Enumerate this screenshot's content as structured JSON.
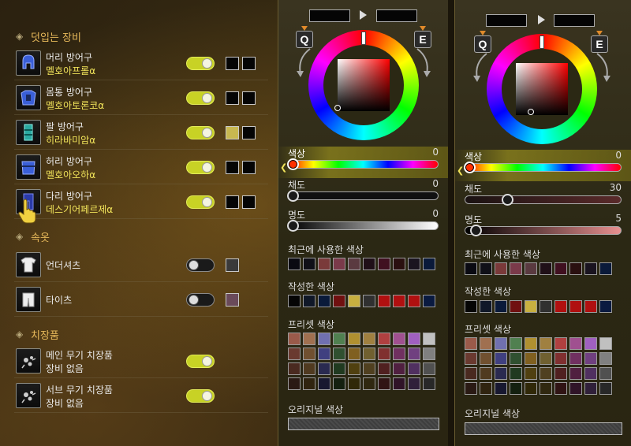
{
  "sections": {
    "armor_title": "덧입는 장비",
    "inner_title": "속옷",
    "decor_title": "치장품"
  },
  "armor": [
    {
      "type": "머리 방어구",
      "name": "멜호아프롤α",
      "toggle": "on",
      "swatches": [
        "#050505",
        "#050505"
      ],
      "icon": "helmet-icon"
    },
    {
      "type": "몸통 방어구",
      "name": "멜호아토론코α",
      "toggle": "on",
      "swatches": [
        "#050505",
        "#050505"
      ],
      "icon": "chest-armor-icon"
    },
    {
      "type": "팔 방어구",
      "name": "히라바미암α",
      "toggle": "on",
      "swatches": [
        "#c8b850",
        "#050505"
      ],
      "icon": "arm-armor-icon"
    },
    {
      "type": "허리 방어구",
      "name": "멜호아오하α",
      "toggle": "on",
      "swatches": [
        "#050505",
        "#050505"
      ],
      "icon": "waist-armor-icon"
    },
    {
      "type": "다리 방어구",
      "name": "데스기어페르제α",
      "toggle": "on",
      "swatches": [
        "#050505",
        "#050505"
      ],
      "icon": "leg-armor-icon"
    }
  ],
  "inner": [
    {
      "type": "언더셔츠",
      "toggle": "off",
      "swatch": "#3a3a3a",
      "icon": "undershirt-icon"
    },
    {
      "type": "타이츠",
      "toggle": "off",
      "swatch": "#6a4a5a",
      "icon": "tights-icon"
    }
  ],
  "decor": [
    {
      "type": "메인 무기 치장품",
      "name": "장비 없음",
      "toggle": "on",
      "icon": "weapon-decor-icon"
    },
    {
      "type": "서브 무기 치장품",
      "name": "장비 없음",
      "toggle": "on",
      "icon": "weapon-decor-icon"
    }
  ],
  "keys": {
    "left": "Q",
    "right": "E"
  },
  "labels": {
    "hue": "색상",
    "saturation": "채도",
    "brightness": "명도",
    "recent": "최근에 사용한 색상",
    "created": "작성한 색상",
    "preset": "프리셋 색상",
    "original": "오리지널 색상"
  },
  "panel_a": {
    "hue": 0,
    "saturation": 0,
    "brightness": 0
  },
  "panel_b": {
    "hue": 0,
    "saturation": 30,
    "brightness": 5
  },
  "colors": {
    "recent": [
      "#0a0a12",
      "#101018",
      "#7a3a3a",
      "#7a3a4a",
      "#5a3a40",
      "#201018",
      "#401020",
      "#2a1010",
      "#1a1420",
      "#0a1a3a"
    ],
    "created": [
      "#050505",
      "#101828",
      "#0a1a3a",
      "#701010",
      "#c8b040",
      "#303030",
      "#b01010",
      "#b01010",
      "#b01010",
      "#0a1a40"
    ],
    "preset": [
      "#9a5a4a",
      "#a07050",
      "#7070b0",
      "#508050",
      "#b09030",
      "#a08040",
      "#b04040",
      "#a05090",
      "#a060c0",
      "#c0c0c0",
      "#6a3a30",
      "#705030",
      "#404080",
      "#305030",
      "#806020",
      "#706030",
      "#803030",
      "#703060",
      "#704080",
      "#808080",
      "#4a2a20",
      "#503a20",
      "#2a2a50",
      "#203a20",
      "#504010",
      "#504020",
      "#502020",
      "#502040",
      "#503060",
      "#505050",
      "#2a1a14",
      "#302410",
      "#181830",
      "#142010",
      "#302808",
      "#302810",
      "#301414",
      "#301428",
      "#30203a",
      "#282828"
    ]
  }
}
